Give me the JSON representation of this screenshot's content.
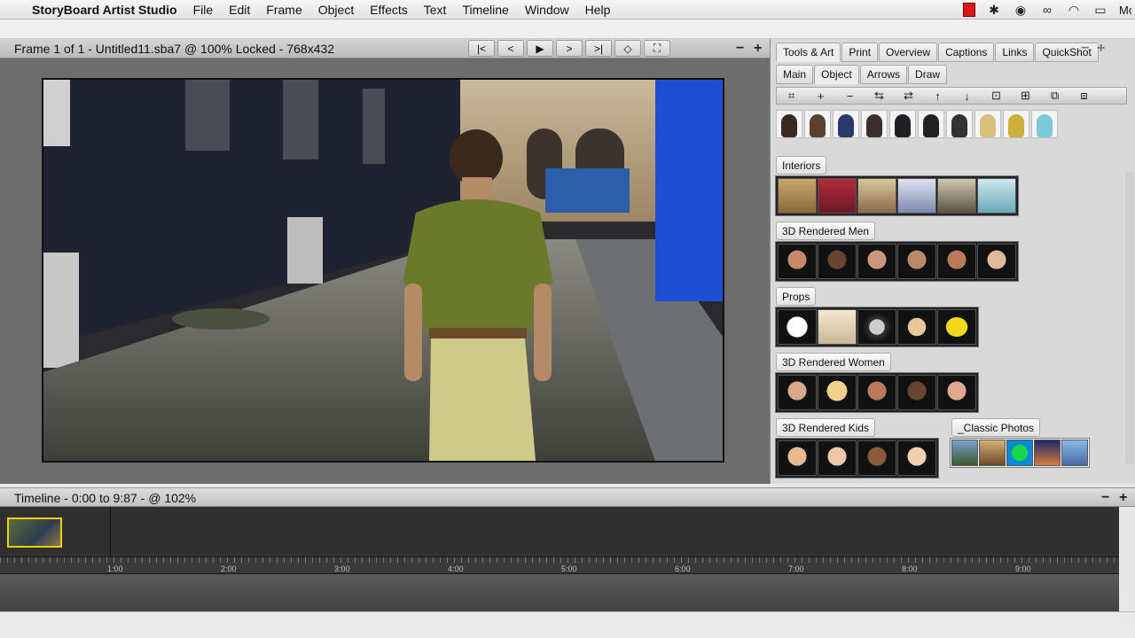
{
  "menubar": {
    "app_name": "StoryBoard Artist Studio",
    "items": [
      "File",
      "Edit",
      "Frame",
      "Object",
      "Effects",
      "Text",
      "Timeline",
      "Window",
      "Help"
    ],
    "status_truncated": "Mo"
  },
  "frame": {
    "title": "Frame 1 of 1 - Untitled11.sba7 @ 100% Locked - 768x432",
    "transport": [
      "K",
      "<",
      "▶",
      ">",
      "K",
      "◇",
      "⛶"
    ],
    "zoom_minus": "−",
    "zoom_plus": "+"
  },
  "right_panel": {
    "tabs_row1": [
      "Tools & Art",
      "Print",
      "Overview",
      "Captions",
      "Links",
      "QuickShot"
    ],
    "active_tab1": "Tools & Art",
    "tabs_row2": [
      "Main",
      "Object",
      "Arrows",
      "Draw"
    ],
    "active_tab2": "Object",
    "icon_toolbar": [
      "⌗",
      "+",
      "−",
      "⇆",
      "⇄",
      "↑",
      "↓",
      "⊡",
      "⊞",
      "⧉",
      "⧈"
    ],
    "sections": {
      "interiors": "Interiors",
      "men": "3D Rendered Men",
      "props": "Props",
      "women": "3D Rendered Women",
      "kids": "3D Rendered Kids",
      "classic": "_Classic Photos"
    }
  },
  "timeline": {
    "title": "Timeline - 0:00 to 9:87 - @ 102%",
    "ruler_labels": [
      "1:00",
      "2:00",
      "3:00",
      "4:00",
      "5:00",
      "6:00",
      "7:00",
      "8:00",
      "9:00"
    ],
    "zoom_minus": "−",
    "zoom_plus": "+"
  }
}
